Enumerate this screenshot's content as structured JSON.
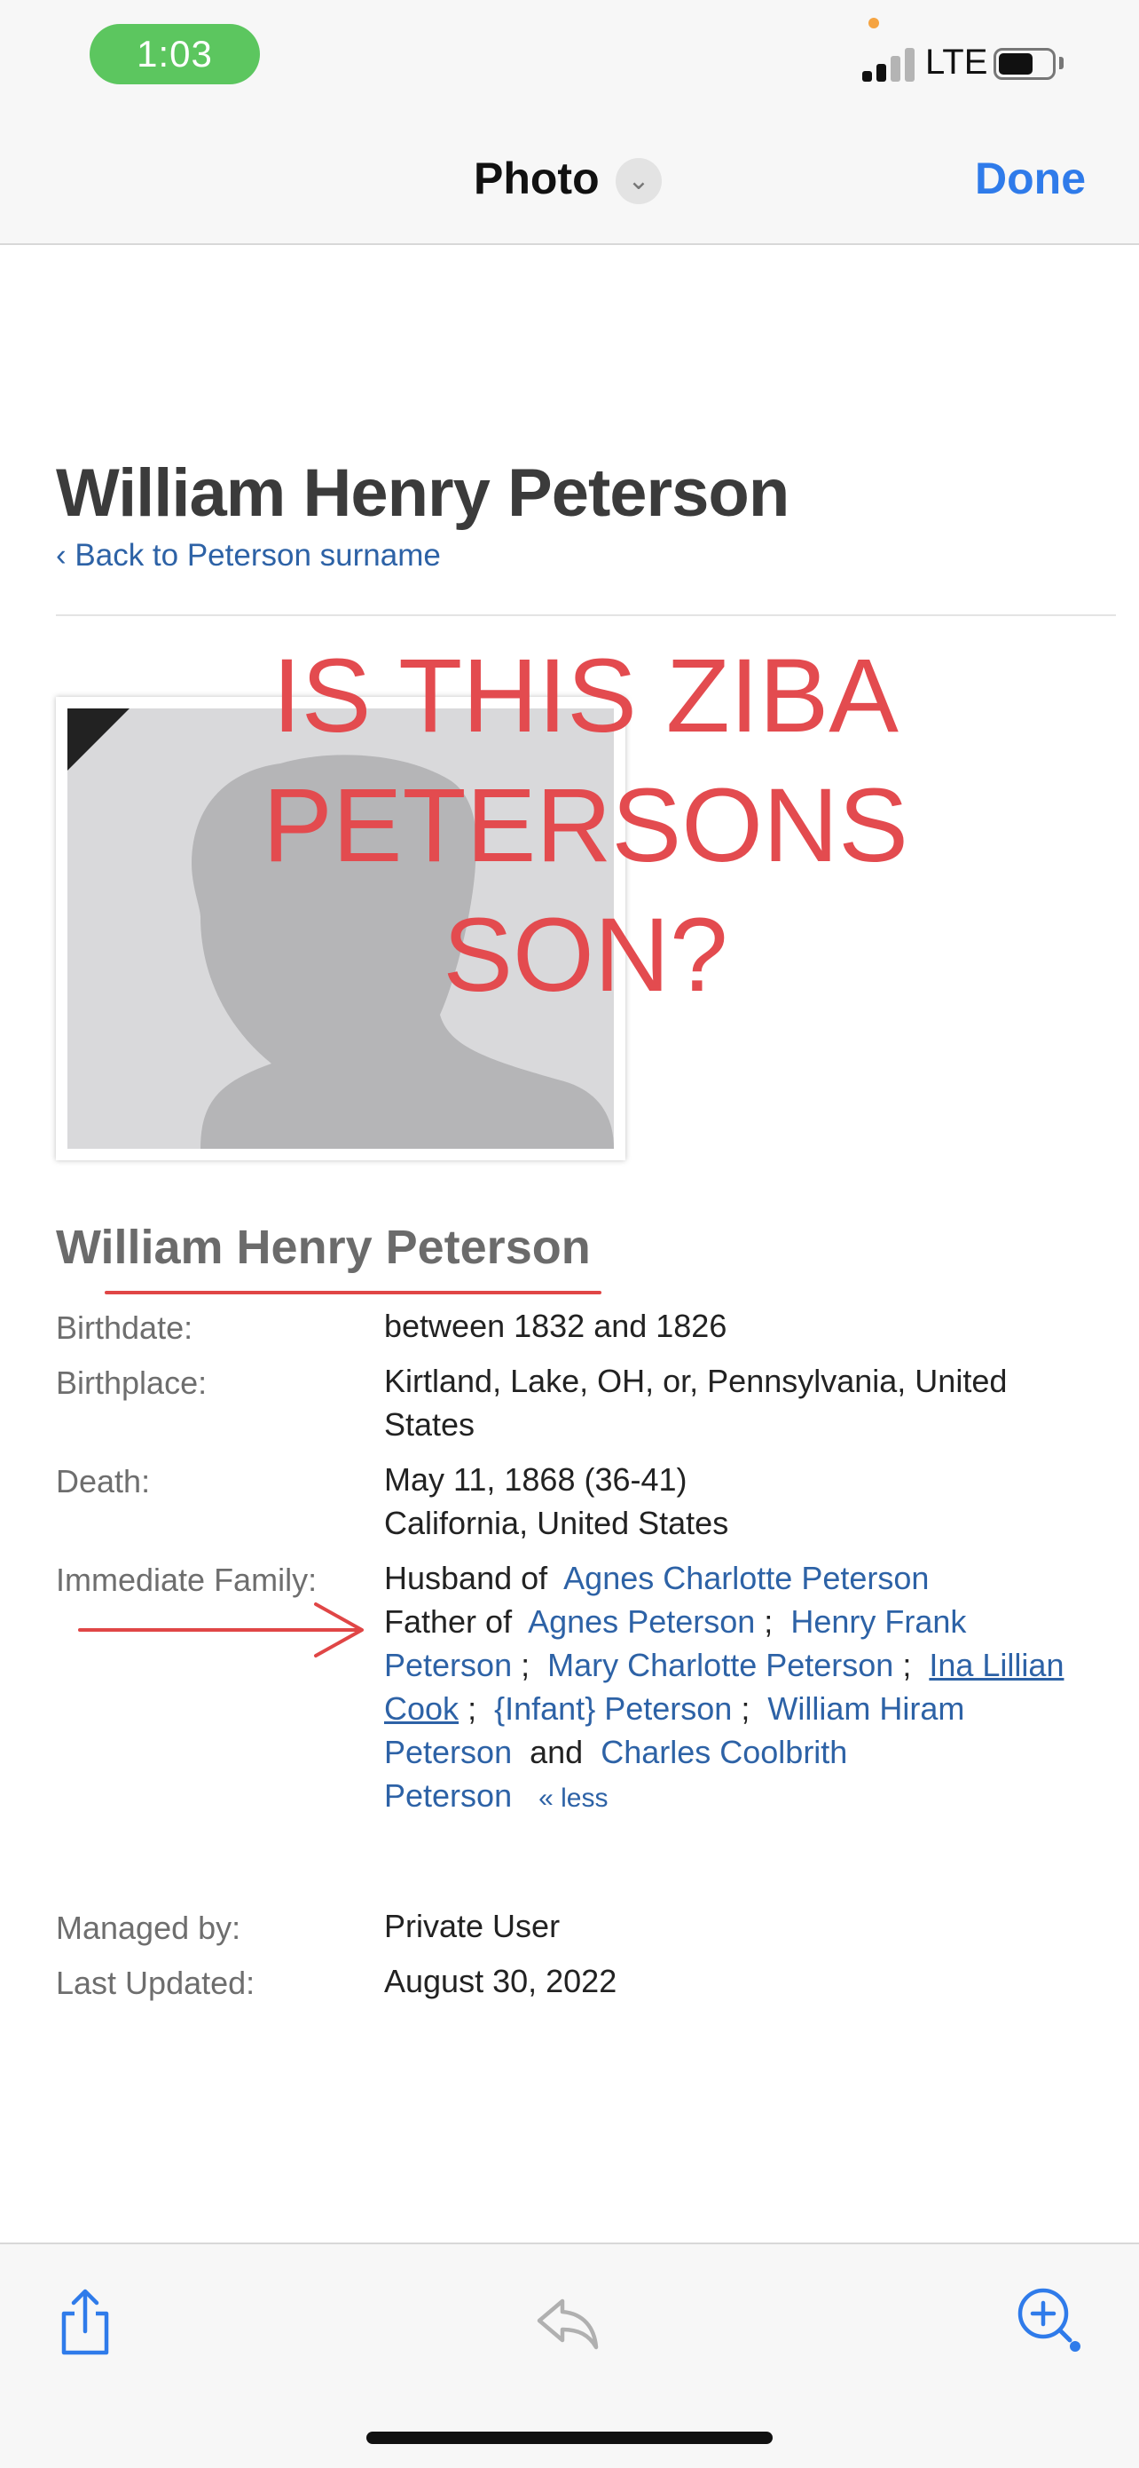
{
  "status_bar": {
    "time": "1:03",
    "network": "LTE"
  },
  "nav": {
    "title": "Photo",
    "done_label": "Done"
  },
  "profile": {
    "title": "William Henry Peterson",
    "back_link": "‹ Back to Peterson surname",
    "annotation_text": "IS THIS ZIBA\nPETERSONS\nSON?",
    "section_name": "William Henry Peterson",
    "labels": {
      "birthdate": "Birthdate:",
      "birthplace": "Birthplace:",
      "death": "Death:",
      "family": "Immediate Family:",
      "managed_by": "Managed by:",
      "last_updated": "Last Updated:"
    },
    "birthdate": "between 1832 and 1826",
    "birthplace_line1": "Kirtland, Lake, OH, or, Pennsylvania, United",
    "birthplace_line2": "States",
    "death_line1": "May 11, 1868 (36-41)",
    "death_line2": "California, United States",
    "family": {
      "husband_prefix": "Husband of",
      "spouse": "Agnes Charlotte Peterson",
      "father_prefix": "Father of",
      "children": [
        "Agnes Peterson",
        "Henry Frank Peterson",
        "Mary Charlotte Peterson",
        "Ina Lillian Cook",
        "{Infant} Peterson",
        "William Hiram Peterson",
        "Charles Coolbrith Peterson"
      ],
      "separator": ";",
      "and_word": "and",
      "less_label": "« less"
    },
    "managed_by": "Private User",
    "last_updated": "August 30, 2022"
  },
  "colors": {
    "link": "#2d62a6",
    "accent": "#2f7bea",
    "annotation": "#e34b4f",
    "status_pill": "#5cc65f"
  },
  "toolbar": {
    "icons": [
      "share-icon",
      "reply-icon",
      "markup-icon"
    ]
  }
}
